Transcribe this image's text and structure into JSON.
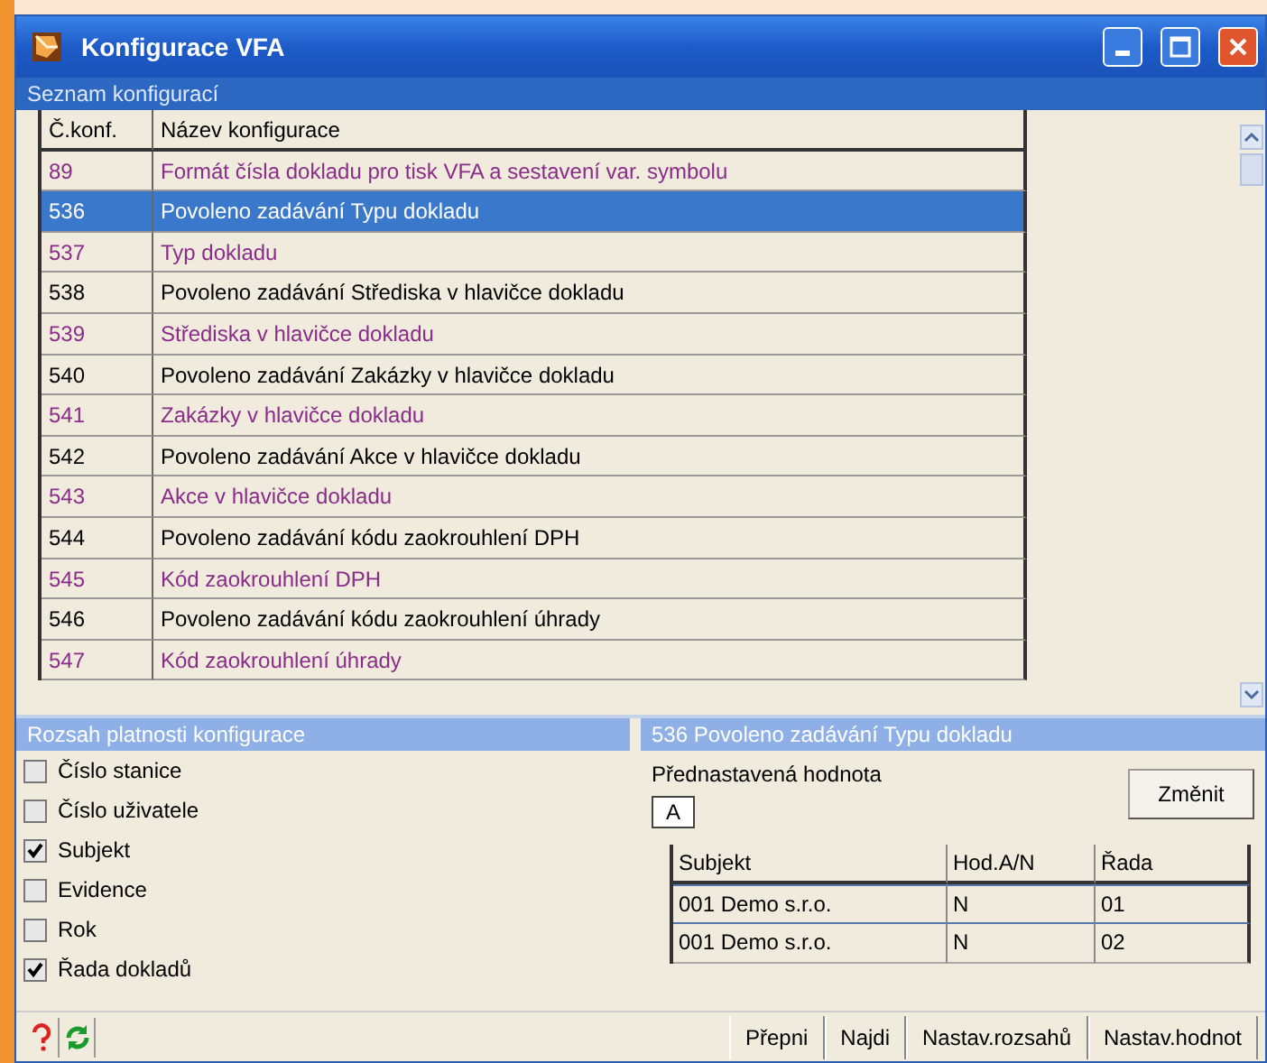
{
  "window": {
    "title": "Konfigurace VFA"
  },
  "list_section": {
    "title": "Seznam konfigurací"
  },
  "table": {
    "columns": [
      "Č.konf.",
      "Název konfigurace"
    ],
    "rows": [
      {
        "number": "89",
        "name": "Formát čísla dokladu pro tisk VFA a sestavení var. symbolu",
        "kind": "value",
        "selected": false
      },
      {
        "number": "536",
        "name": "Povoleno zadávání Typu dokladu",
        "kind": "permission",
        "selected": true
      },
      {
        "number": "537",
        "name": "Typ dokladu",
        "kind": "value",
        "selected": false
      },
      {
        "number": "538",
        "name": "Povoleno zadávání Střediska v hlavičce dokladu",
        "kind": "permission",
        "selected": false
      },
      {
        "number": "539",
        "name": "Střediska v hlavičce dokladu",
        "kind": "value",
        "selected": false
      },
      {
        "number": "540",
        "name": "Povoleno zadávání Zakázky v hlavičce dokladu",
        "kind": "permission",
        "selected": false
      },
      {
        "number": "541",
        "name": "Zakázky v hlavičce dokladu",
        "kind": "value",
        "selected": false
      },
      {
        "number": "542",
        "name": "Povoleno zadávání Akce v hlavičce dokladu",
        "kind": "permission",
        "selected": false
      },
      {
        "number": "543",
        "name": "Akce v hlavičce dokladu",
        "kind": "value",
        "selected": false
      },
      {
        "number": "544",
        "name": "Povoleno zadávání kódu zaokrouhlení DPH",
        "kind": "permission",
        "selected": false
      },
      {
        "number": "545",
        "name": "Kód zaokrouhlení DPH",
        "kind": "value",
        "selected": false
      },
      {
        "number": "546",
        "name": "Povoleno zadávání kódu zaokrouhlení úhrady",
        "kind": "permission",
        "selected": false
      },
      {
        "number": "547",
        "name": "Kód zaokrouhlení úhrady",
        "kind": "value",
        "selected": false
      }
    ]
  },
  "scope": {
    "title": "Rozsah platnosti konfigurace",
    "options": [
      {
        "label": "Číslo stanice",
        "checked": false
      },
      {
        "label": "Číslo uživatele",
        "checked": false
      },
      {
        "label": "Subjekt",
        "checked": true
      },
      {
        "label": "Evidence",
        "checked": false
      },
      {
        "label": "Rok",
        "checked": false
      },
      {
        "label": "Řada dokladů",
        "checked": true
      }
    ]
  },
  "detail": {
    "title": "536  Povoleno zadávání Typu dokladu",
    "default_label": "Přednastavená hodnota",
    "default_value": "A",
    "change_button": "Změnit",
    "columns": [
      "Subjekt",
      "Hod.A/N",
      "Řada"
    ],
    "rows": [
      {
        "cells": [
          "001 Demo s.r.o.",
          "N",
          "01"
        ],
        "selected": true
      },
      {
        "cells": [
          "001 Demo s.r.o.",
          "N",
          "02"
        ],
        "selected": false
      }
    ]
  },
  "footer": {
    "buttons": [
      "Přepni",
      "Najdi",
      "Nastav.rozsahů",
      "Nastav.hodnot"
    ]
  }
}
